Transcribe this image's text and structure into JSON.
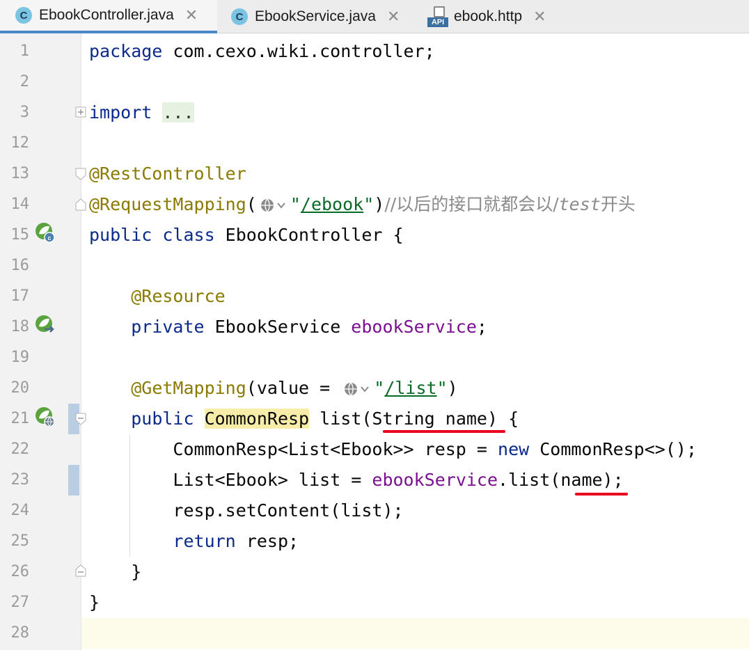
{
  "tabs": [
    {
      "label": "EbookController.java",
      "icon": "class-icon",
      "active": true
    },
    {
      "label": "EbookService.java",
      "icon": "class-icon",
      "active": false
    },
    {
      "label": "ebook.http",
      "icon": "api-icon",
      "active": false
    }
  ],
  "tab_icon_letter": "C",
  "tab_api_badge": "API",
  "line_numbers": [
    "1",
    "2",
    "3",
    "12",
    "13",
    "14",
    "15",
    "16",
    "17",
    "18",
    "19",
    "20",
    "21",
    "22",
    "23",
    "24",
    "25",
    "26",
    "27",
    "28"
  ],
  "code": {
    "l1_kw": "package",
    "l1_rest": " com.cexo.wiki.controller;",
    "l3_kw": "import",
    "l3_folded": "...",
    "l13_an": "@RestController",
    "l14_an": "@RequestMapping",
    "l14_paren": "(",
    "l14_q1": "\"",
    "l14_path": "/ebook",
    "l14_q2": "\"",
    "l14_close": ")",
    "l14_cmt1": "//以后的接口就都会以/",
    "l14_cmt_it": "test",
    "l14_cmt2": "开头",
    "l15_kw": "public class",
    "l15_rest": " EbookController {",
    "l17_an": "@Resource",
    "l18_kw": "private",
    "l18_type": " EbookService ",
    "l18_fld": "ebookService",
    "l18_end": ";",
    "l20_an": "@GetMapping",
    "l20_mid": "(value = ",
    "l20_q1": "\"",
    "l20_path": "/list",
    "l20_q2": "\"",
    "l20_end": ")",
    "l21_kw": "public",
    "l21_sp": " ",
    "l21_type": "CommonResp",
    "l21_rest": " list(String name) {",
    "l22_a": "CommonResp<List<Ebook>> resp = ",
    "l22_kw": "new",
    "l22_b": " CommonResp<>();",
    "l23_a": "List<Ebook> list = ",
    "l23_fld": "ebookService",
    "l23_b": ".list(name);",
    "l24": "resp.setContent(list);",
    "l25_kw": "return",
    "l25_rest": " resp;",
    "l26": "}",
    "l27": "}"
  },
  "colors": {
    "keyword": "#0b2a8a",
    "annotation": "#8a7a00",
    "field": "#7a0f8f",
    "string": "#0a6a27",
    "comment": "#8b8b8b",
    "underline": "#e8001c",
    "tab_accent": "#4a88c7"
  }
}
